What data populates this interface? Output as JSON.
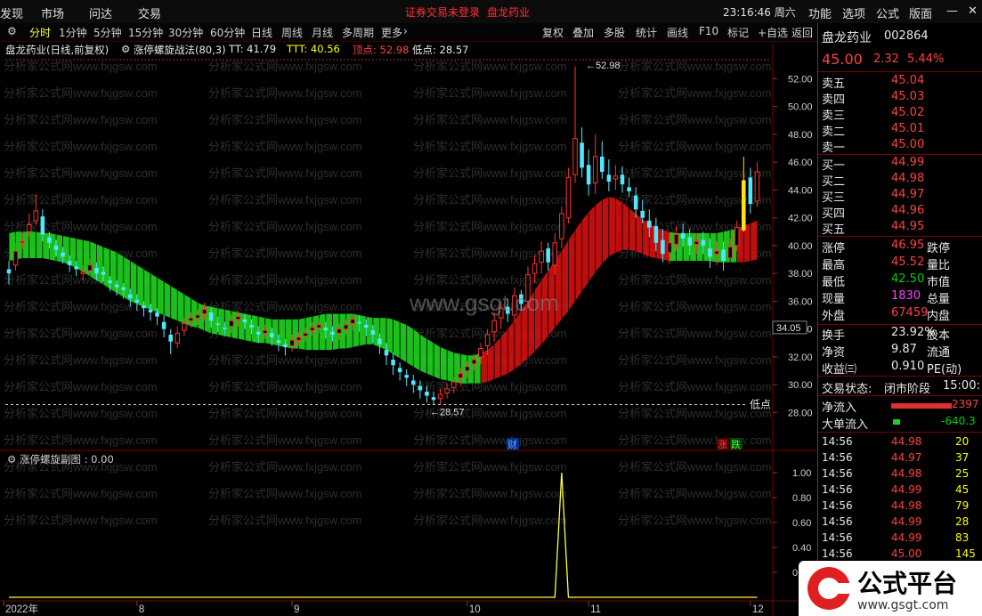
{
  "menu": {
    "items": [
      "发现",
      "市场",
      "问达",
      "交易"
    ],
    "notice": "证券交易未登录",
    "stock": "盘龙药业",
    "time": "23:16:46 周六",
    "right": [
      "功能",
      "选项",
      "公式",
      "版面"
    ]
  },
  "tabs": [
    "分时",
    "1分钟",
    "5分钟",
    "15分钟",
    "30分钟",
    "60分钟",
    "日线",
    "周线",
    "月线",
    "多周期",
    "更多"
  ],
  "toolbar": [
    "复权",
    "叠加",
    "多股",
    "统计",
    "画线",
    "F10",
    "标记",
    "+自选",
    "返回"
  ],
  "info": {
    "title": "盘龙药业(日线,前复权)",
    "indicator": "涨停螺旋战法(80,3)",
    "tt": "TT: 41.79",
    "ttt": "TTT: 40.56",
    "top": "顶点: 52.98",
    "low": "低点: 28.57"
  },
  "sub": {
    "title": "涨停螺旋副图 : 0.00"
  },
  "watermark": "www.gsgt.com",
  "bgwater": "分析家公式网www.fxjgsw.com",
  "chart_data": {
    "type": "candlestick",
    "ylim": [
      27,
      53.5
    ],
    "yticks": [
      "52.00",
      "50.00",
      "48.00",
      "46.00",
      "44.00",
      "42.00",
      "40.00",
      "38.00",
      "36.00",
      "34.00",
      "32.00",
      "30.00",
      "28.00"
    ],
    "ytick_values": [
      52,
      50,
      48,
      46,
      44,
      42,
      40,
      38,
      36,
      34,
      32,
      30,
      28
    ],
    "xlabels": [
      "2022年",
      "8",
      "9",
      "10",
      "11",
      "12"
    ],
    "xlabel_index": [
      0,
      19,
      42,
      68,
      86,
      110
    ],
    "peak_label": "52.98",
    "low_label": "28.57",
    "low_marker": "低点",
    "current_label": "34.05",
    "events": [
      "财",
      "涨",
      "跌"
    ],
    "sub_ylim": [
      0,
      1.1
    ],
    "sub_yticks": [
      "1.00",
      "0.80",
      "0.60",
      "0.40",
      "0.20"
    ],
    "sub_ytick_values": [
      1.0,
      0.8,
      0.6,
      0.4,
      0.2
    ],
    "sub_spikes": [
      82,
      117
    ],
    "closes": [
      38.0,
      39.6,
      40.3,
      41.5,
      42.5,
      40.8,
      40.2,
      39.7,
      39.2,
      38.6,
      38.3,
      38.1,
      38.6,
      38.0,
      37.9,
      37.3,
      37.0,
      36.8,
      36.2,
      35.9,
      35.5,
      35.2,
      34.9,
      34.0,
      33.1,
      33.7,
      34.4,
      34.8,
      35.0,
      35.4,
      34.6,
      34.3,
      34.0,
      34.6,
      34.9,
      34.5,
      34.1,
      33.6,
      33.9,
      33.4,
      33.0,
      32.7,
      33.2,
      33.4,
      33.7,
      34.1,
      34.3,
      33.9,
      33.6,
      34.0,
      34.3,
      34.7,
      34.4,
      34.1,
      33.6,
      32.9,
      32.1,
      31.4,
      30.9,
      30.5,
      30.0,
      29.6,
      29.2,
      28.9,
      29.3,
      29.7,
      30.2,
      30.8,
      31.3,
      31.8,
      32.6,
      33.6,
      34.6,
      35.5,
      35.1,
      36.4,
      35.8,
      37.9,
      38.7,
      39.6,
      38.8,
      40.2,
      42.3,
      44.9,
      47.7,
      45.6,
      44.4,
      46.4,
      45.3,
      44.6,
      45.0,
      44.4,
      43.9,
      42.6,
      42.0,
      41.3,
      40.2,
      39.4,
      40.2,
      40.8,
      40.5,
      40.0,
      40.3,
      40.0,
      39.2,
      39.6,
      38.9,
      39.9,
      41.3,
      44.7,
      43.0,
      45.3
    ],
    "opens": [
      38.3,
      38.6,
      40.2,
      41.0,
      41.8,
      42.1,
      40.6,
      40.0,
      39.5,
      38.9,
      38.5,
      38.0,
      38.2,
      38.4,
      38.1,
      37.5,
      37.2,
      37.0,
      36.5,
      36.1,
      35.7,
      35.4,
      35.2,
      34.5,
      33.6,
      33.0,
      33.9,
      34.6,
      34.8,
      35.1,
      35.2,
      34.4,
      34.1,
      34.2,
      34.7,
      34.7,
      34.3,
      33.8,
      33.7,
      33.7,
      33.2,
      32.9,
      32.8,
      33.2,
      33.5,
      33.9,
      34.1,
      34.1,
      33.8,
      33.7,
      34.0,
      34.4,
      34.5,
      34.3,
      33.9,
      33.3,
      32.5,
      31.8,
      31.2,
      30.7,
      30.3,
      29.9,
      29.5,
      29.1,
      29.0,
      29.4,
      29.8,
      30.5,
      31.0,
      31.5,
      32.0,
      32.8,
      33.8,
      34.8,
      35.6,
      35.0,
      36.5,
      36.0,
      38.0,
      38.8,
      39.8,
      38.6,
      40.5,
      42.0,
      45.1,
      47.4,
      45.8,
      44.5,
      46.4,
      45.1,
      44.8,
      45.1,
      44.2,
      43.6,
      42.5,
      41.8,
      41.4,
      40.4,
      39.5,
      40.1,
      40.9,
      40.6,
      40.1,
      40.4,
      39.8,
      39.4,
      39.7,
      39.1,
      40.0,
      41.1,
      44.9,
      43.2
    ],
    "highs": [
      38.9,
      40.2,
      40.9,
      42.3,
      43.7,
      42.6,
      41.0,
      40.4,
      39.9,
      39.3,
      38.9,
      38.6,
      39.1,
      38.8,
      38.5,
      37.8,
      37.5,
      37.3,
      36.9,
      36.5,
      36.0,
      35.8,
      35.5,
      35.0,
      34.0,
      34.2,
      34.8,
      35.2,
      35.4,
      35.9,
      35.6,
      34.9,
      34.5,
      35.0,
      35.3,
      35.1,
      34.7,
      34.2,
      34.3,
      34.1,
      33.6,
      33.3,
      33.6,
      33.8,
      34.1,
      34.5,
      34.8,
      34.5,
      34.2,
      34.4,
      34.7,
      35.1,
      35.0,
      34.7,
      34.3,
      33.7,
      33.0,
      32.3,
      31.6,
      31.1,
      30.7,
      30.3,
      29.9,
      29.5,
      29.7,
      30.1,
      30.6,
      31.2,
      31.7,
      32.2,
      33.0,
      34.0,
      35.2,
      36.0,
      36.2,
      37.0,
      36.8,
      38.5,
      39.3,
      40.3,
      40.2,
      40.9,
      42.8,
      45.6,
      52.9,
      48.5,
      46.9,
      48.0,
      47.5,
      46.2,
      45.8,
      45.7,
      44.9,
      44.2,
      43.3,
      42.6,
      42.0,
      41.2,
      40.9,
      41.4,
      41.6,
      41.2,
      40.9,
      41.0,
      40.5,
      40.3,
      40.3,
      40.5,
      41.8,
      46.4,
      45.6,
      46.0
    ],
    "lows": [
      37.2,
      38.2,
      39.8,
      40.6,
      41.5,
      40.3,
      39.8,
      39.2,
      38.7,
      38.1,
      37.8,
      37.5,
      37.9,
      37.5,
      37.4,
      36.7,
      36.4,
      36.2,
      35.6,
      35.3,
      34.9,
      34.6,
      34.3,
      33.4,
      32.2,
      32.6,
      33.5,
      34.1,
      34.3,
      34.6,
      34.1,
      33.8,
      33.5,
      33.7,
      34.2,
      34.0,
      33.6,
      33.0,
      33.3,
      32.8,
      32.4,
      32.1,
      32.4,
      32.8,
      33.1,
      33.5,
      33.7,
      33.3,
      33.1,
      33.2,
      33.6,
      33.9,
      33.8,
      33.5,
      33.0,
      32.2,
      31.4,
      30.7,
      30.3,
      29.9,
      29.4,
      29.0,
      28.7,
      28.6,
      28.6,
      29.0,
      29.4,
      29.9,
      30.5,
      31.0,
      31.5,
      32.1,
      33.1,
      34.0,
      34.5,
      34.5,
      35.3,
      35.5,
      37.3,
      38.0,
      38.2,
      37.9,
      39.8,
      41.6,
      44.5,
      44.9,
      43.6,
      43.7,
      44.8,
      43.9,
      44.0,
      43.8,
      43.5,
      42.0,
      41.6,
      40.6,
      39.6,
      38.8,
      38.7,
      39.6,
      39.9,
      39.3,
      39.4,
      39.4,
      38.4,
      38.6,
      38.2,
      39.1,
      39.6,
      41.0,
      42.3,
      42.8
    ],
    "ribbon_fast": [
      39.8,
      39.9,
      40.0,
      40.0,
      40.0,
      40.0,
      39.9,
      39.8,
      39.7,
      39.5,
      39.3,
      39.0,
      38.7,
      38.4,
      38.1,
      37.8,
      37.5,
      37.2,
      36.9,
      36.7,
      36.5,
      36.3,
      36.1,
      35.9,
      35.7,
      35.5,
      35.3,
      35.1,
      35.0,
      34.8,
      34.7,
      34.6,
      34.5,
      34.4,
      34.3,
      34.2,
      34.1,
      34.0,
      33.9,
      33.8,
      33.7,
      33.6,
      33.5,
      33.5,
      33.4,
      33.4,
      33.4,
      33.4,
      33.4,
      33.5,
      33.5,
      33.6,
      33.7,
      33.8,
      33.9,
      33.9,
      33.9,
      33.8,
      33.6,
      33.4,
      33.1,
      32.7,
      32.4,
      32.1,
      31.8,
      31.6,
      31.4,
      31.3,
      31.2,
      31.2,
      31.4,
      31.6,
      32.0,
      32.5,
      33.1,
      33.7,
      34.4,
      35.1,
      35.9,
      36.6,
      37.3,
      38.0,
      38.7,
      39.5,
      40.2,
      40.9,
      41.5,
      42.0,
      42.4,
      42.6,
      42.5,
      42.2,
      41.8,
      41.4,
      41.0,
      40.7,
      40.4,
      40.2,
      40.1,
      40.0,
      40.0,
      40.0,
      40.0,
      40.0,
      40.0,
      40.0,
      40.1,
      40.2,
      40.3,
      40.5,
      40.7,
      40.9
    ],
    "ribbon_slow": [
      40.0,
      40.1,
      40.1,
      40.1,
      40.1,
      40.0,
      40.0,
      39.9,
      39.8,
      39.7,
      39.6,
      39.5,
      39.4,
      39.2,
      39.0,
      38.8,
      38.6,
      38.3,
      38.0,
      37.7,
      37.4,
      37.1,
      36.8,
      36.5,
      36.2,
      35.9,
      35.6,
      35.3,
      35.0,
      34.8,
      34.6,
      34.5,
      34.4,
      34.3,
      34.2,
      34.1,
      34.0,
      33.9,
      33.9,
      33.8,
      33.8,
      33.8,
      33.8,
      33.8,
      33.9,
      34.0,
      34.1,
      34.2,
      34.2,
      34.2,
      34.2,
      34.2,
      34.1,
      34.0,
      33.8,
      33.6,
      33.4,
      33.1,
      32.8,
      32.5,
      32.2,
      31.9,
      31.7,
      31.5,
      31.3,
      31.2,
      31.1,
      31.0,
      31.0,
      31.0,
      31.0,
      31.1,
      31.3,
      31.5,
      31.7,
      32.0,
      32.4,
      32.8,
      33.3,
      33.8,
      34.4,
      35.0,
      35.6,
      36.2,
      36.9,
      37.6,
      38.3,
      39.0,
      39.6,
      40.1,
      40.4,
      40.6,
      40.6,
      40.5,
      40.3,
      40.1,
      40.0,
      39.9,
      39.8,
      39.8,
      39.8,
      39.8,
      39.8,
      39.8,
      39.8,
      39.7,
      39.7,
      39.7,
      39.7,
      39.7,
      39.8,
      39.9
    ]
  },
  "right": {
    "name": "盘龙药业",
    "code": "002864",
    "price": "45.00",
    "chg": "2.32",
    "pct": "5.44%",
    "asks": [
      [
        "卖五",
        "45.04"
      ],
      [
        "卖四",
        "45.03"
      ],
      [
        "卖三",
        "45.02"
      ],
      [
        "卖二",
        "45.01"
      ],
      [
        "卖一",
        "45.00"
      ]
    ],
    "bids": [
      [
        "买一",
        "44.99"
      ],
      [
        "买二",
        "44.98"
      ],
      [
        "买三",
        "44.97"
      ],
      [
        "买四",
        "44.96"
      ],
      [
        "买五",
        "44.95"
      ]
    ],
    "stats": [
      [
        "涨停",
        "46.95",
        "跌停"
      ],
      [
        "最高",
        "45.52",
        "量比"
      ],
      [
        "最低",
        "42.50",
        "市值"
      ],
      [
        "现量",
        "1830",
        "总量"
      ],
      [
        "外盘",
        "67459",
        "内盘"
      ]
    ],
    "stats2": [
      [
        "换手",
        "23.92%",
        "股本"
      ],
      [
        "净资",
        "9.87",
        "流通"
      ],
      [
        "收益㈢",
        "0.910",
        "PE(动)"
      ]
    ],
    "status_label": "交易状态:",
    "status_value": "闭市阶段",
    "status_time": "15:00:",
    "netflow_label": "净流入",
    "netflow_value": "2397",
    "bigflow_label": "大单流入",
    "bigflow_value": "-640.3",
    "ticks": [
      [
        "14:56",
        "44.98",
        "20"
      ],
      [
        "14:56",
        "44.97",
        "37"
      ],
      [
        "14:56",
        "44.98",
        "25"
      ],
      [
        "14:56",
        "44.99",
        "45"
      ],
      [
        "14:56",
        "44.98",
        "79"
      ],
      [
        "14:56",
        "44.99",
        "28"
      ],
      [
        "14:56",
        "44.99",
        "83"
      ],
      [
        "14:56",
        "45.00",
        "145"
      ]
    ]
  },
  "logo": {
    "main": "公式平台",
    "url": "www.gsgt.com"
  }
}
